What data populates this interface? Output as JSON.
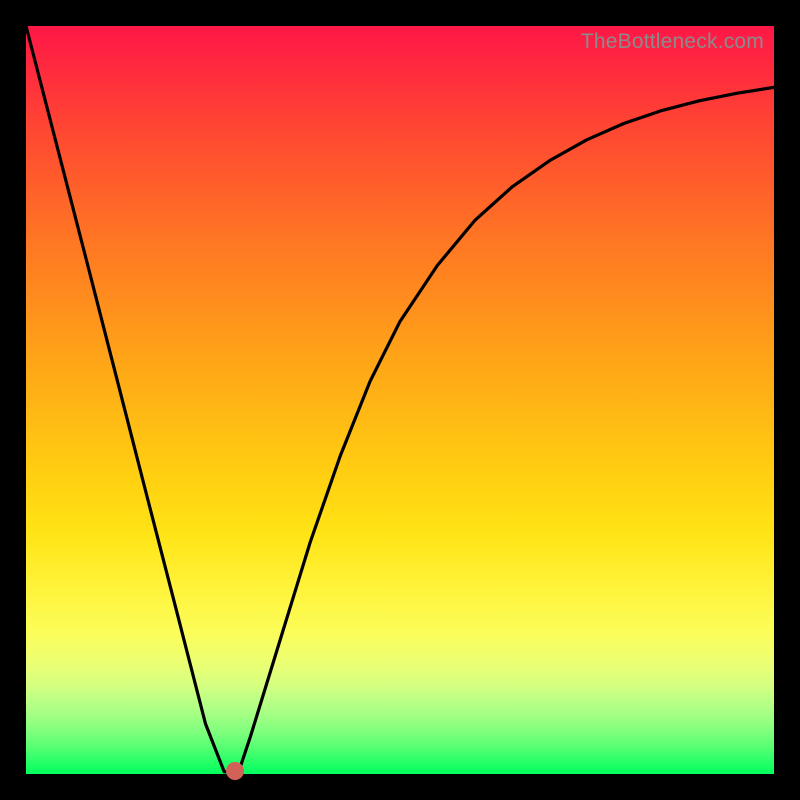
{
  "watermark": "TheBottleneck.com",
  "colors": {
    "marker": "#d26158",
    "curve_stroke": "#000000"
  },
  "chart_data": {
    "type": "line",
    "title": "",
    "xlabel": "",
    "ylabel": "",
    "xlim": [
      0,
      100
    ],
    "ylim": [
      0,
      100
    ],
    "x": [
      0,
      4,
      8,
      12,
      16,
      20,
      24,
      26.5,
      27.5,
      28.5,
      30,
      34,
      38,
      42,
      46,
      50,
      55,
      60,
      65,
      70,
      75,
      80,
      85,
      90,
      95,
      100
    ],
    "values": [
      100,
      84.5,
      69,
      53.4,
      37.8,
      22.3,
      6.7,
      0.3,
      0.3,
      0.5,
      5,
      18,
      31,
      42.5,
      52.5,
      60.5,
      68,
      74,
      78.5,
      82,
      84.8,
      87,
      88.7,
      90,
      91,
      91.8
    ],
    "marker": {
      "x": 28,
      "y": 0.4
    },
    "grid": false,
    "legend": false
  }
}
